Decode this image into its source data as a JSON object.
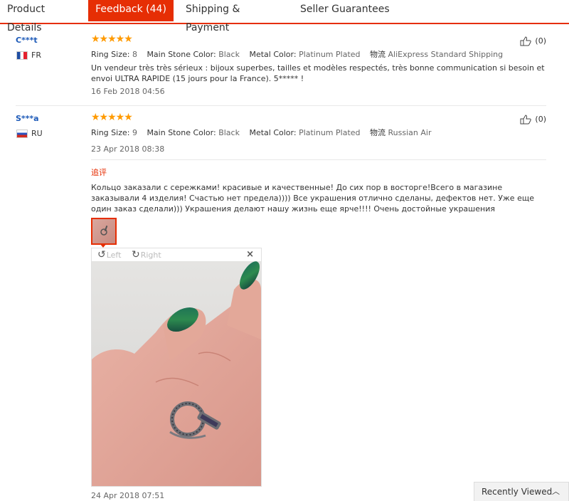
{
  "tabs": [
    {
      "label": "Product Details",
      "active": false
    },
    {
      "label": "Feedback (44)",
      "active": true
    },
    {
      "label": "Shipping & Payment",
      "active": false
    },
    {
      "label": "Seller Guarantees",
      "active": false
    }
  ],
  "reviews": [
    {
      "user": "C***t",
      "country": "FR",
      "stars": "★★★★★",
      "rating": 5,
      "ring_size_label": "Ring Size:",
      "ring_size": "8",
      "stone_label": "Main Stone Color:",
      "stone": "Black",
      "metal_label": "Metal Color:",
      "metal": "Platinum Plated",
      "shipping_label": "物流",
      "shipping": "AliExpress Standard Shipping",
      "text": "Un vendeur très très sérieux : bijoux superbes, tailles et modèles respectés, très bonne communication si besoin et envoi ULTRA RAPIDE (15 jours pour la France). 5***** !",
      "date": "16 Feb 2018 04:56",
      "helpful": "(0)"
    },
    {
      "user": "S***a",
      "country": "RU",
      "stars": "★★★★★",
      "rating": 5,
      "ring_size_label": "Ring Size:",
      "ring_size": "9",
      "stone_label": "Main Stone Color:",
      "stone": "Black",
      "metal_label": "Metal Color:",
      "metal": "Platinum Plated",
      "shipping_label": "物流",
      "shipping": "Russian Air",
      "date": "23 Apr 2018 08:38",
      "helpful": "(0)",
      "additional_label": "追评",
      "additional_text": "Кольцо заказали с сережками! красивые и качественные! До сих пор в восторге!Всего в магазине заказывали 4 изделия! Счастью нет предела)))) Все украшения отлично сделаны, дефектов нет. Уже еще один заказ сделали))) Украшения делают нашу жизнь еще ярче!!!! Очень достойные украшения",
      "additional_date": "24 Apr 2018 07:51",
      "viewer": {
        "rotate_left": "Left",
        "rotate_right": "Right",
        "close": "×"
      }
    }
  ],
  "recently_viewed": {
    "label": "Recently Viewed",
    "icon": "chevron-up-icon"
  },
  "colors": {
    "accent": "#e62e04",
    "star": "#ff9a00",
    "username": "#1d5ab8"
  }
}
